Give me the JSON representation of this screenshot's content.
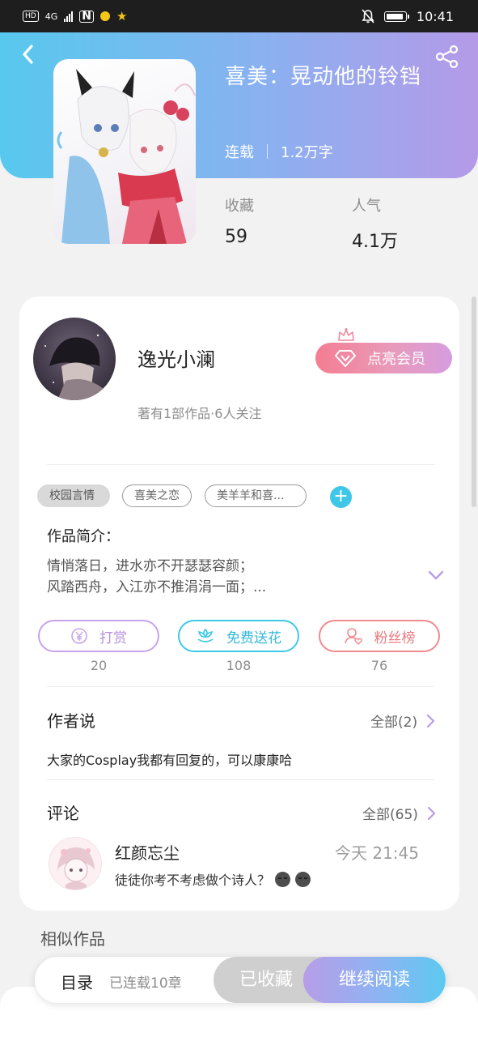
{
  "status_bar": {
    "hd": "HD",
    "network": "4G",
    "time": "10:41"
  },
  "book": {
    "title": "喜美：晃动他的铃铛",
    "status": "连载",
    "word_count": "1.2万字",
    "stats": [
      {
        "label": "收藏",
        "value": "59"
      },
      {
        "label": "人气",
        "value": "4.1万"
      }
    ]
  },
  "author": {
    "name": "逸光小澜",
    "subtitle": "著有1部作品·6人关注",
    "vip_button": "点亮会员"
  },
  "tags": [
    "校园言情",
    "喜美之恋",
    "美羊羊和喜..."
  ],
  "intro": {
    "heading": "作品简介：",
    "line1": "情悄落日，进水亦不开瑟瑟容颜；",
    "line2": "风踏西舟，入江亦不推涓涓一面；..."
  },
  "actions": [
    {
      "label": "打赏",
      "count": "20",
      "icon": "yen-coin-icon",
      "color": "#c7a3e8"
    },
    {
      "label": "免费送花",
      "count": "108",
      "icon": "flower-icon",
      "color": "#3fc7e8"
    },
    {
      "label": "粉丝榜",
      "count": "76",
      "icon": "fan-user-icon",
      "color": "#f08a8f"
    }
  ],
  "author_says": {
    "heading": "作者说",
    "link": "全部(2)",
    "text": "大家的Cosplay我都有回复的，可以康康哈"
  },
  "comments": {
    "heading": "评论",
    "link": "全部(65)",
    "items": [
      {
        "name": "红颜忘尘",
        "time": "今天 21:45",
        "text": "徒徒你考不考虑做个诗人？"
      }
    ]
  },
  "similar_heading": "相似作品",
  "bottom_bar": {
    "toc": "目录",
    "chapters": "已连载10章",
    "favorited": "已收藏",
    "continue": "继续阅读"
  },
  "colors": {
    "header_start": "#57c9ee",
    "header_end": "#b59ae8",
    "accent_cyan": "#3fc7e8"
  }
}
